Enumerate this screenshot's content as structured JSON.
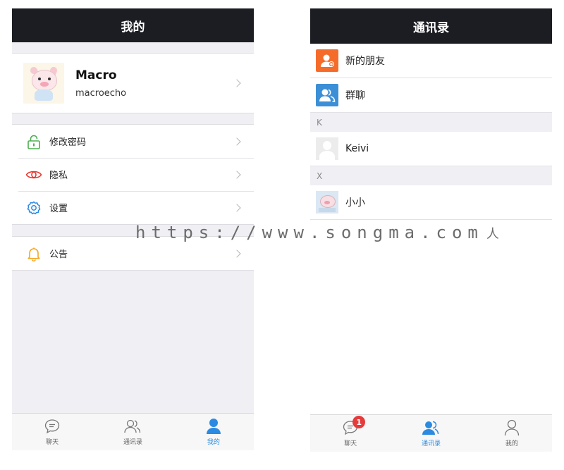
{
  "left_screen": {
    "title": "我的",
    "profile": {
      "name": "Macro",
      "account": "macroecho"
    },
    "menu": [
      {
        "label": "修改密码",
        "icon": "lock-icon",
        "color": "#4caf50"
      },
      {
        "label": "隐私",
        "icon": "eye-icon",
        "color": "#e53935"
      },
      {
        "label": "设置",
        "icon": "gear-icon",
        "color": "#2c8be0"
      }
    ],
    "notice": {
      "label": "公告",
      "icon": "bell-icon",
      "color": "#f5a623"
    },
    "tabs": [
      {
        "label": "聊天",
        "icon": "chat-icon",
        "active": false
      },
      {
        "label": "通讯录",
        "icon": "contacts-icon",
        "active": false
      },
      {
        "label": "我的",
        "icon": "person-icon",
        "active": true
      }
    ]
  },
  "right_screen": {
    "title": "通讯录",
    "top_items": [
      {
        "label": "新的朋友",
        "icon": "add-friend-icon",
        "color": "#f56c2a"
      },
      {
        "label": "群聊",
        "icon": "group-chat-icon",
        "color": "#3b8fd6"
      }
    ],
    "sections": [
      {
        "letter": "K",
        "contacts": [
          {
            "name": "Keivi",
            "avatar": "default-avatar"
          }
        ]
      },
      {
        "letter": "X",
        "contacts": [
          {
            "name": "小小",
            "avatar": "pig-avatar"
          }
        ]
      }
    ],
    "tabs": [
      {
        "label": "聊天",
        "icon": "chat-icon",
        "active": false,
        "badge": "1"
      },
      {
        "label": "通讯录",
        "icon": "contacts-icon",
        "active": true
      },
      {
        "label": "我的",
        "icon": "person-icon",
        "active": false
      }
    ]
  },
  "watermark": {
    "text": "https://www.songma.com",
    "mark": "人"
  },
  "colors": {
    "titlebar": "#1b1d22",
    "active_tab": "#2c8be0",
    "badge": "#e53b3b"
  }
}
